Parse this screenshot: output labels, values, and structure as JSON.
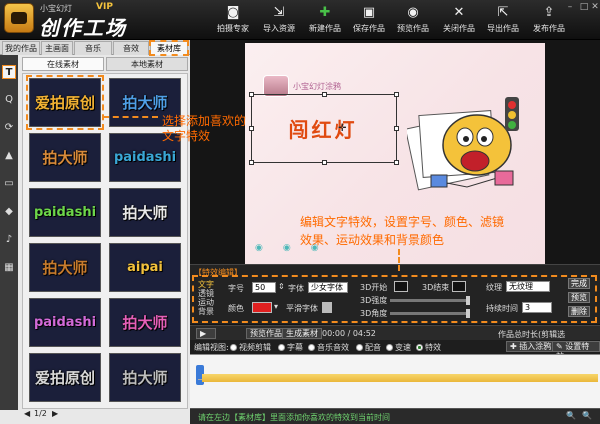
{
  "app": {
    "title_small": "小宝幻灯",
    "vip": "VIP",
    "title_big": "创作工场"
  },
  "toolbar": {
    "items": [
      {
        "label": "拍摄专家",
        "icon": "camera-icon"
      },
      {
        "label": "导入资源",
        "icon": "import-icon"
      },
      {
        "label": "新建作品",
        "icon": "new-icon"
      },
      {
        "label": "保存作品",
        "icon": "save-icon"
      },
      {
        "label": "预览作品",
        "icon": "eye-icon"
      },
      {
        "label": "关闭作品",
        "icon": "close-doc-icon"
      },
      {
        "label": "导出作品",
        "icon": "export-icon"
      },
      {
        "label": "发布作品",
        "icon": "publish-icon"
      }
    ]
  },
  "left_tabs": [
    "我的作品",
    "主画面",
    "音乐",
    "音效",
    "素材库"
  ],
  "sub_tabs": [
    "在线素材",
    "本地素材"
  ],
  "side_icons": [
    "T",
    "Q",
    "⟳",
    "▲",
    "▭",
    "◆",
    "♪",
    "▦"
  ],
  "effects": [
    {
      "text": "爱拍原创",
      "color": "#f2b233"
    },
    {
      "text": "拍大师",
      "color": "#4f9fe6"
    },
    {
      "text": "拍大师",
      "color": "#d88a3a"
    },
    {
      "text": "paidashi",
      "color": "#3aa7d6"
    },
    {
      "text": "paidashi",
      "color": "#6dd64a"
    },
    {
      "text": "拍大师",
      "color": "#e8e8e8"
    },
    {
      "text": "拍大师",
      "color": "#c77b2d"
    },
    {
      "text": "aipai",
      "color": "#f3c23c"
    },
    {
      "text": "paidashi",
      "color": "#d26ad8"
    },
    {
      "text": "拍大师",
      "color": "#e55fb8"
    },
    {
      "text": "爱拍原创",
      "color": "#d8d8d8"
    },
    {
      "text": "拍大师",
      "color": "#bdbdbd"
    }
  ],
  "pager": "1/2",
  "preview": {
    "caption": "小宝幻灯涂鸦",
    "text_title": "闯红灯"
  },
  "annotations": {
    "left": "选择添加喜欢的文字特效",
    "bottom": "编辑文字特效，设置字号、颜色、滤镜效果、运动效果和背景颜色"
  },
  "fx_panel": {
    "title": "【特效编辑】",
    "categories": [
      "文字",
      "透镜",
      "运动",
      "背景"
    ],
    "size_label": "字号",
    "size_value": "50",
    "font_label": "字体",
    "font_value": "少女字体",
    "color_label": "颜色",
    "color_value": "#e02020",
    "smooth_label": "平滑字体",
    "start3d_label": "3D开始",
    "end3d_label": "3D结束",
    "strength_label": "3D强度",
    "angle_label": "3D角度",
    "texture_label": "纹理",
    "texture_value": "无纹理",
    "duration_label": "持续时间",
    "duration_value": "3",
    "btn_done": "完成",
    "btn_preview": "预览",
    "btn_delete": "删除"
  },
  "timeline": {
    "preview_btn": "预览作品",
    "generate_btn": "生成素材",
    "time": "00:00 / 04:52",
    "total": "作品总时长(剪辑选取):04:52",
    "edit_view": "编辑视图:",
    "views": [
      "视频剪辑",
      "字幕",
      "音乐音效",
      "配音",
      "变速",
      "特效"
    ],
    "active_view": "特效",
    "insert_btn": "插入涂鸦",
    "settings_btn": "设置特效"
  },
  "status": "请在左边【素材库】里面添加你喜欢的特效到当前时间"
}
